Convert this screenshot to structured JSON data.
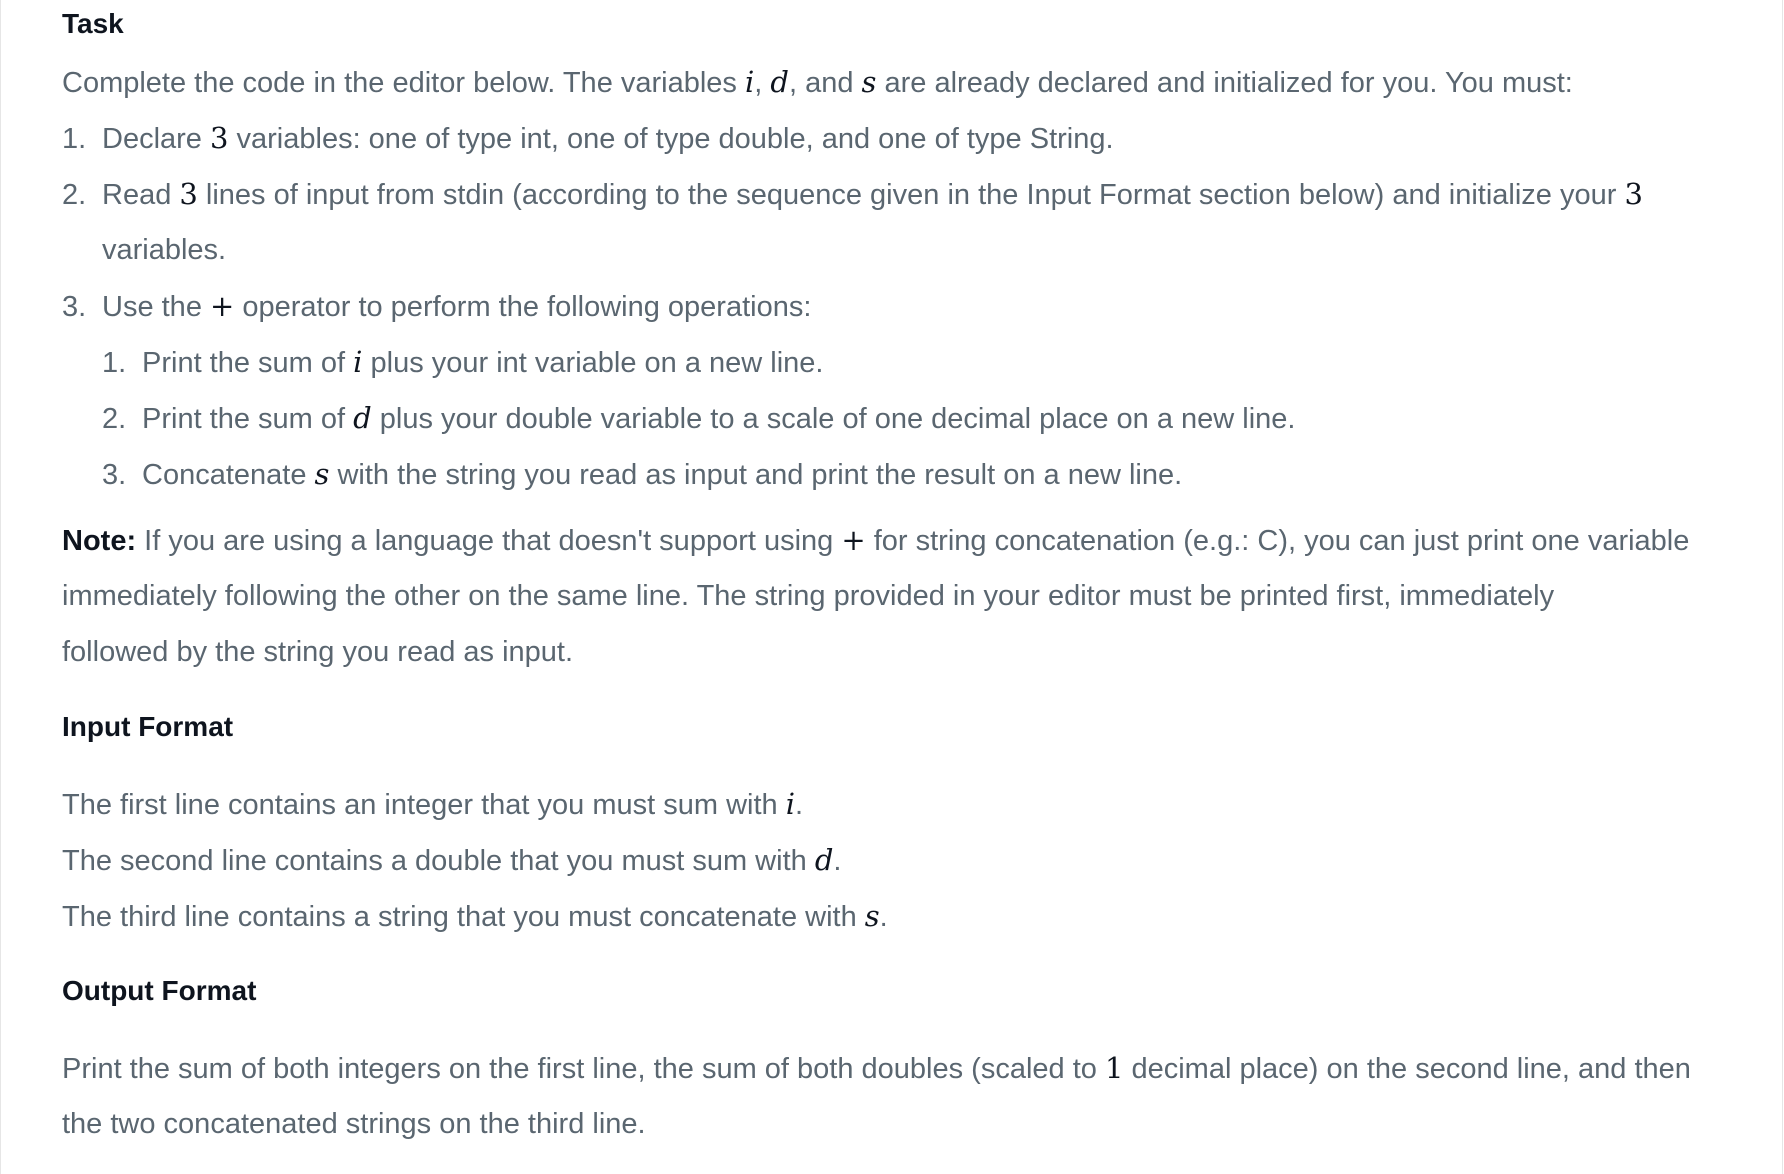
{
  "task": {
    "heading": "Task",
    "intro": {
      "pre": "Complete the code in the editor below. The variables ",
      "var_i": "i",
      "sep1": ", ",
      "var_d": "d",
      "sep2": ", and ",
      "var_s": "s",
      "post": " are already declared and initialized for you. You must:"
    },
    "steps": [
      {
        "number": "1.",
        "pre": "Declare ",
        "math": "3",
        "post": " variables: one of type int, one of type double, and one of type String."
      },
      {
        "number": "2.",
        "pre": "Read ",
        "math": "3",
        "mid": " lines of input from stdin (according to the sequence given in the Input Format section below) and initialize your ",
        "math2": "3",
        "cont": "variables."
      },
      {
        "number": "3.",
        "pre": "Use the ",
        "math": "+",
        "post": " operator to perform the following operations:"
      }
    ],
    "substeps": [
      {
        "number": "1.",
        "pre": "Print the sum of ",
        "math": "i",
        "post": " plus your int variable on a new line."
      },
      {
        "number": "2.",
        "pre": "Print the sum of ",
        "math": "d",
        "post": " plus your double variable to a scale of one decimal place on a new line."
      },
      {
        "number": "3.",
        "pre": "Concatenate ",
        "math": "s",
        "post": " with the string you read as input and print the result on a new line."
      }
    ],
    "note": {
      "label": "Note:",
      "line1_pre": " If you are using a language that doesn't support using ",
      "line1_math": "+",
      "line1_post": " for string concatenation (e.g.: C), you can just print one variable",
      "line2": "immediately following the other on the same line. The string provided in your editor must be printed first, immediately",
      "line3": "followed by the string you read as input."
    }
  },
  "input_format": {
    "heading": "Input Format",
    "lines": [
      {
        "pre": "The first line contains an integer that you must sum with ",
        "math": "i",
        "post": "."
      },
      {
        "pre": "The second line contains a double that you must sum with ",
        "math": "d",
        "post": "."
      },
      {
        "pre": "The third line contains a string that you must concatenate with ",
        "math": "s",
        "post": "."
      }
    ]
  },
  "output_format": {
    "heading": "Output Format",
    "line1_pre": "Print the sum of both integers on the first line, the sum of both doubles (scaled to ",
    "line1_math": "1",
    "line1_post": " decimal place) on the second line, and then",
    "line2": "the two concatenated strings on the third line."
  }
}
